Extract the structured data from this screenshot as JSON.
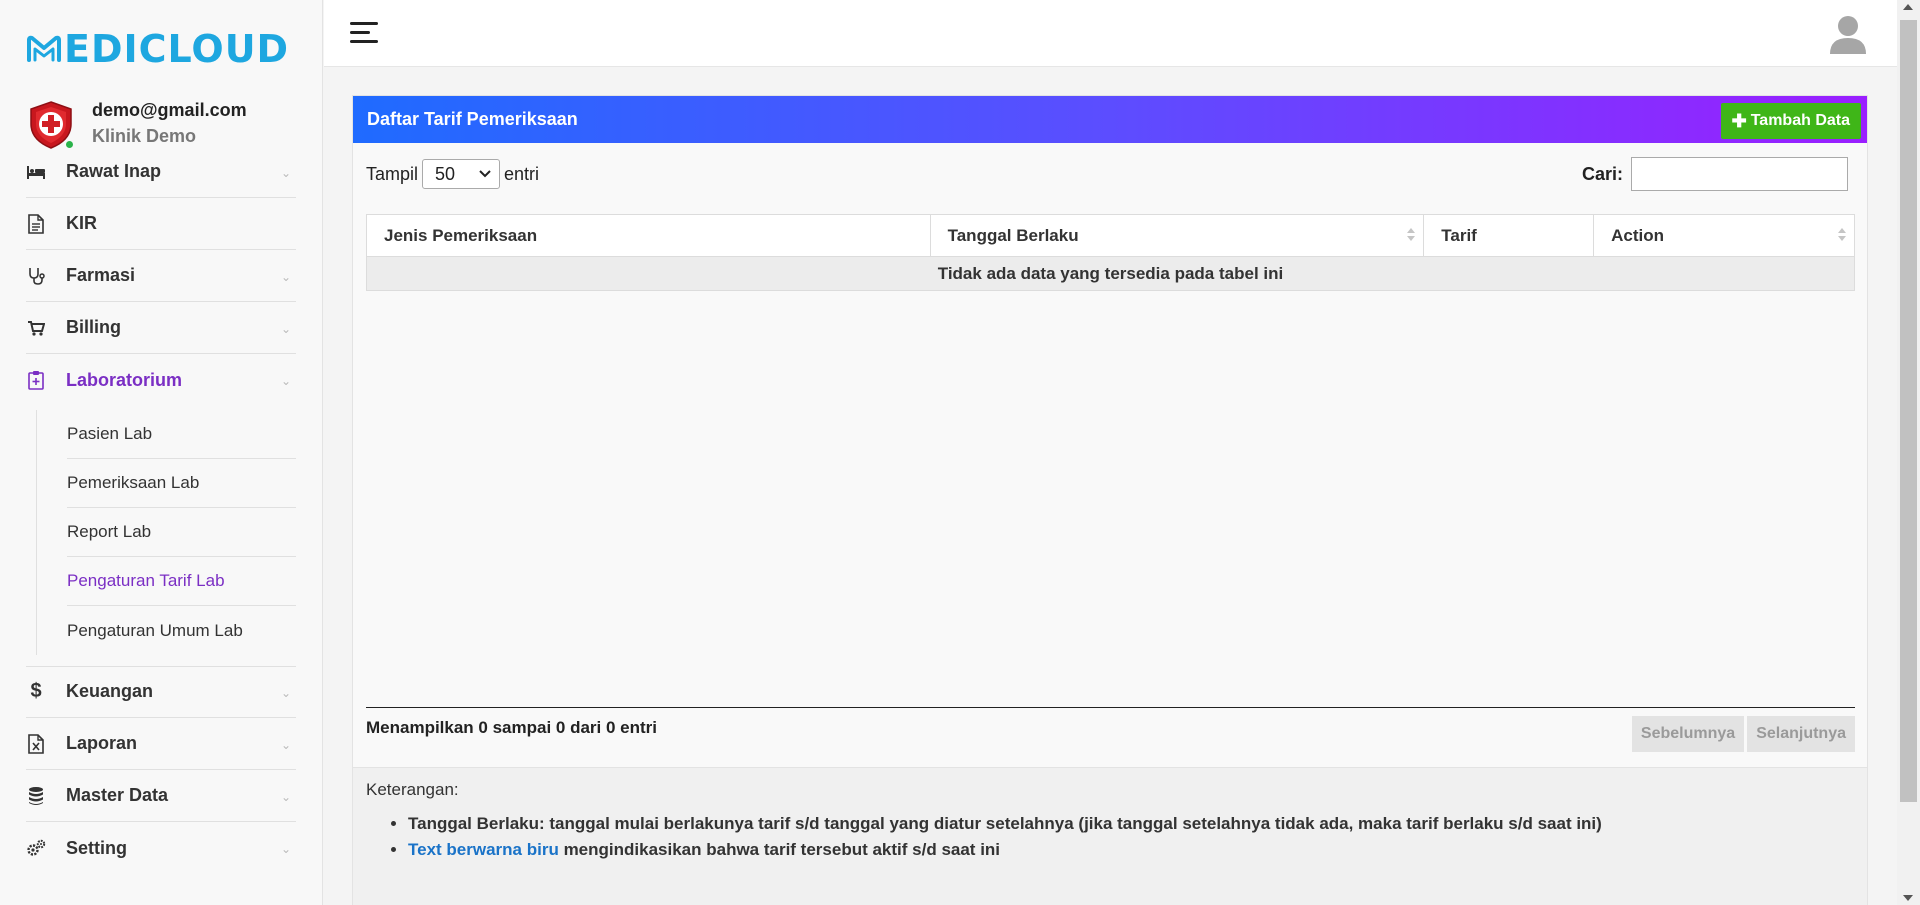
{
  "brand": {
    "logo_text": "EDICLOUD",
    "color": "#1ea7e0"
  },
  "user": {
    "email": "demo@gmail.com",
    "clinic": "Klinik Demo"
  },
  "sidebar": {
    "items": [
      {
        "label": "Rawat Inap",
        "icon": "bed-icon",
        "has_chevron": true
      },
      {
        "label": "KIR",
        "icon": "document-icon",
        "has_chevron": false
      },
      {
        "label": "Farmasi",
        "icon": "stethoscope-icon",
        "has_chevron": true
      },
      {
        "label": "Billing",
        "icon": "cart-icon",
        "has_chevron": true
      },
      {
        "label": "Laboratorium",
        "icon": "clipboard-icon",
        "has_chevron": true,
        "active": true
      },
      {
        "label": "Keuangan",
        "icon": "dollar-icon",
        "has_chevron": true
      },
      {
        "label": "Laporan",
        "icon": "file-excel-icon",
        "has_chevron": true
      },
      {
        "label": "Master Data",
        "icon": "database-icon",
        "has_chevron": true
      },
      {
        "label": "Setting",
        "icon": "cogs-icon",
        "has_chevron": true
      }
    ],
    "lab_sub": [
      {
        "label": "Pasien Lab"
      },
      {
        "label": "Pemeriksaan Lab"
      },
      {
        "label": "Report Lab"
      },
      {
        "label": "Pengaturan Tarif Lab",
        "active": true
      },
      {
        "label": "Pengaturan Umum Lab"
      }
    ],
    "active_color": "#7b2fc4"
  },
  "card": {
    "title": "Daftar Tarif Pemeriksaan",
    "add_button": "Tambah Data",
    "show_label": "Tampil",
    "show_value": "50",
    "entries_label": "entri",
    "search_label": "Cari:",
    "search_value": "",
    "columns": [
      "Jenis Pemeriksaan",
      "Tanggal Berlaku",
      "Tarif",
      "Action"
    ],
    "empty_text": "Tidak ada data yang tersedia pada tabel ini",
    "info": "Menampilkan 0 sampai 0 dari 0 entri",
    "prev": "Sebelumnya",
    "next": "Selanjutnya"
  },
  "notes": {
    "title": "Keterangan:",
    "item1": "Tanggal Berlaku: tanggal mulai berlakunya tarif s/d tanggal yang diatur setelahnya (jika tanggal setelahnya tidak ada, maka tarif berlaku s/d saat ini)",
    "item2_blue": "Text berwarna biru",
    "item2_rest": " mengindikasikan bahwa tarif tersebut aktif s/d saat ini"
  },
  "colors": {
    "header_gradient_start": "#1f6bff",
    "header_gradient_end": "#9a1fff",
    "add_button": "#3fb618",
    "link_blue": "#1a73c8"
  }
}
